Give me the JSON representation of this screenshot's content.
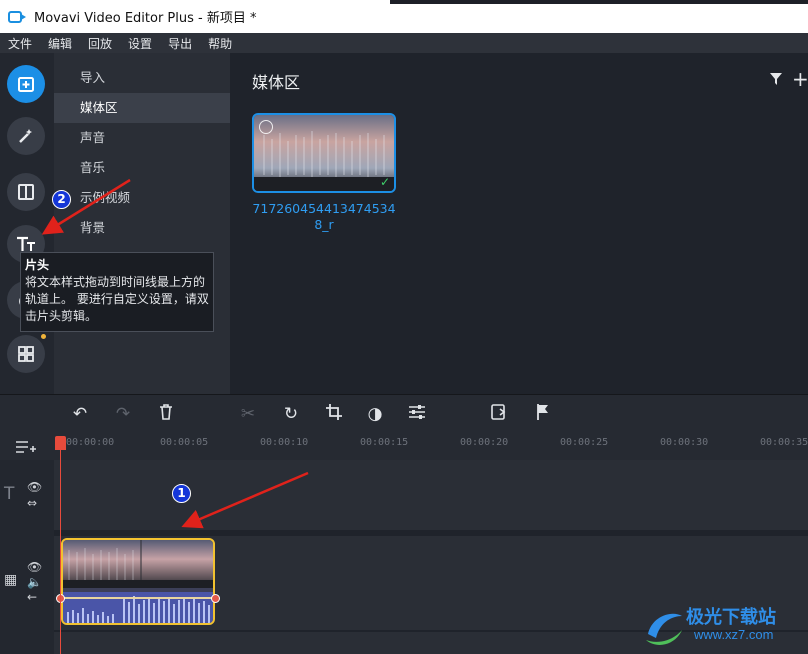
{
  "window": {
    "title": "Movavi Video Editor Plus - 新项目 *"
  },
  "menu": [
    "文件",
    "编辑",
    "回放",
    "设置",
    "导出",
    "帮助"
  ],
  "sidebar_tools": [
    {
      "name": "import",
      "active": true
    },
    {
      "name": "filters"
    },
    {
      "name": "transitions"
    },
    {
      "name": "titles"
    },
    {
      "name": "stickers"
    },
    {
      "name": "more-tools"
    }
  ],
  "categories": [
    {
      "label": "导入"
    },
    {
      "label": "媒体区",
      "selected": true
    },
    {
      "label": "声音"
    },
    {
      "label": "音乐"
    },
    {
      "label": "示例视频"
    },
    {
      "label": "背景"
    }
  ],
  "media": {
    "title": "媒体区",
    "clips": [
      {
        "name": "717260454413474534 8_r"
      }
    ]
  },
  "tooltip": {
    "title": "片头",
    "body": "将文本样式拖动到时间线最上方的轨道上。 要进行自定义设置，请双击片头剪辑。"
  },
  "timeline": {
    "ruler_labels": [
      "00:00:00",
      "00:00:05",
      "00:00:10",
      "00:00:15",
      "00:00:20",
      "00:00:25",
      "00:00:30",
      "00:00:35"
    ]
  },
  "annotations": [
    "1",
    "2"
  ],
  "watermark": {
    "text": "极光下载站",
    "url": "www.xz7.com"
  },
  "colors": {
    "accent": "#1c8fe6",
    "clip_border": "#f2c230",
    "playhead": "#e74b3c",
    "annotation": "#1436d8"
  }
}
